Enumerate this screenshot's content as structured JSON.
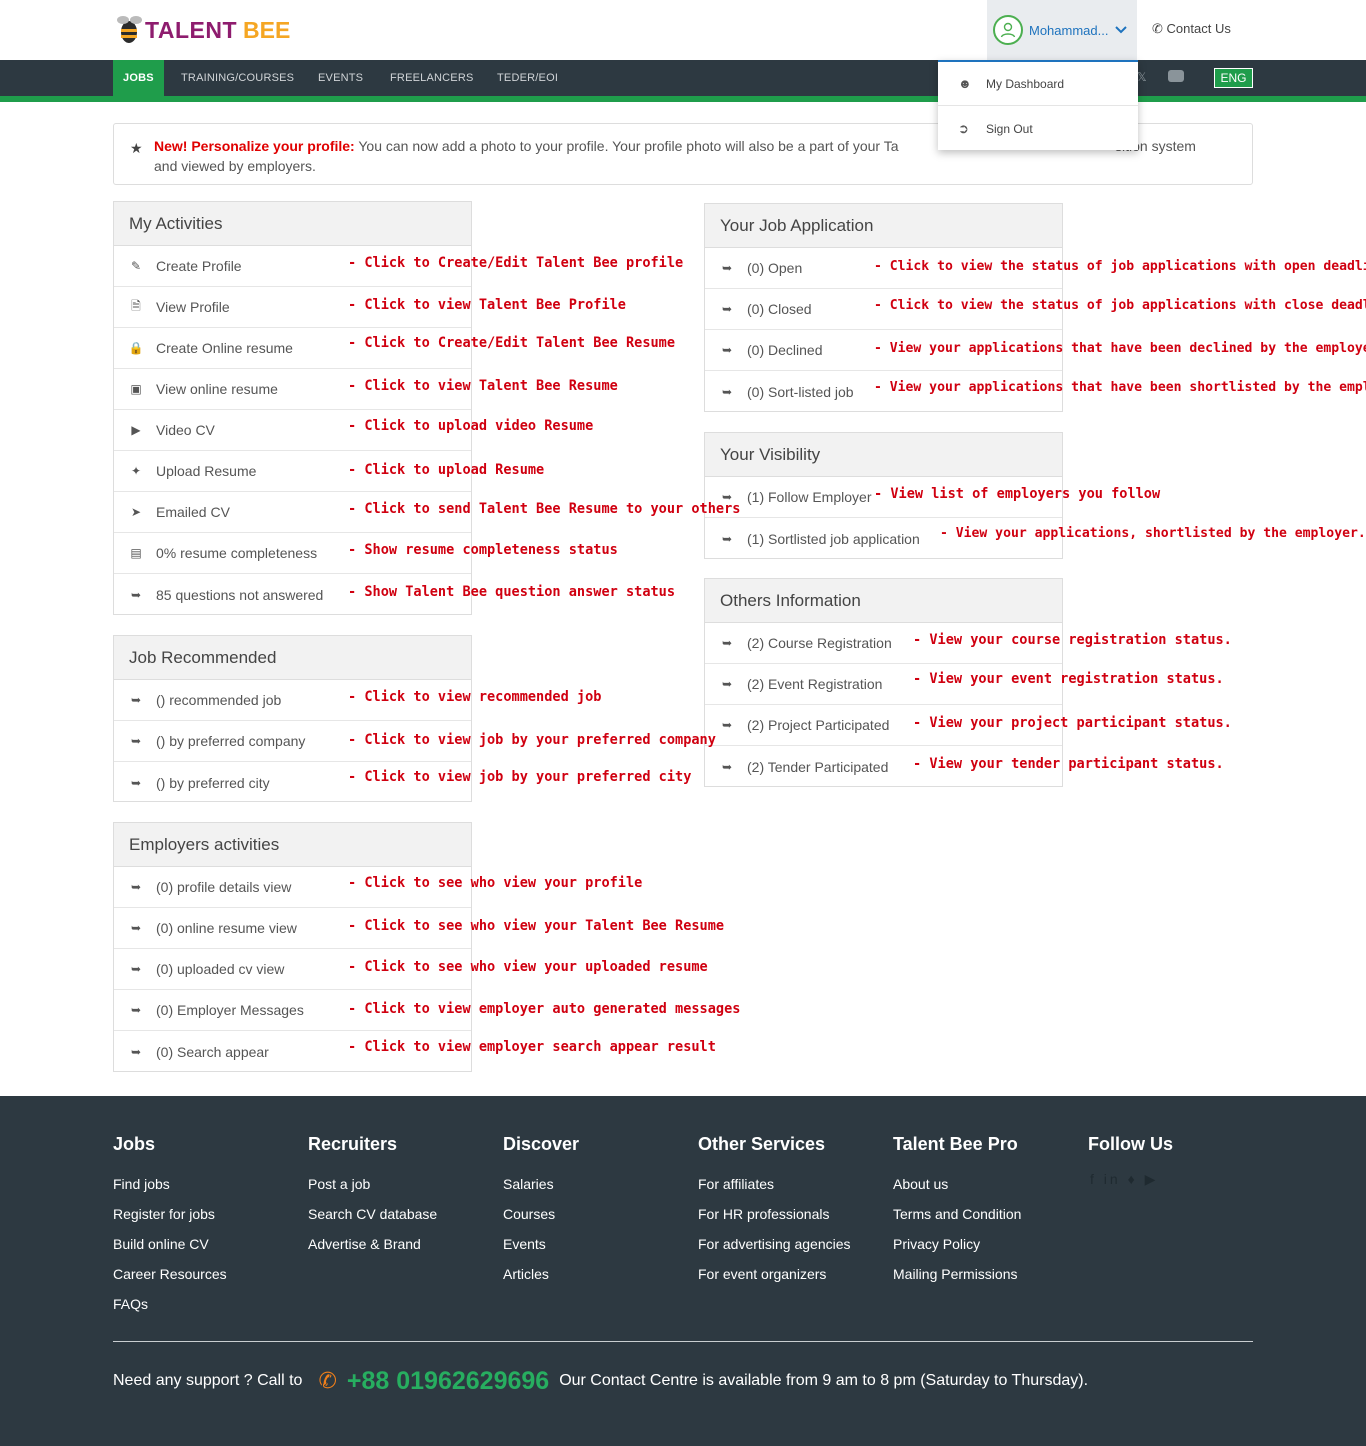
{
  "header": {
    "logo_part1": "TALENT",
    "logo_part2": "BEE",
    "user_name": "Mohammad...",
    "contact_label": "Contact Us"
  },
  "nav": {
    "tabs": [
      "JOBS",
      "TRAINING/COURSES",
      "EVENTS",
      "FREELANCERS",
      "TEDER/EOI"
    ],
    "active_tab": "JOBS",
    "lang": "ENG"
  },
  "user_menu": {
    "items": [
      "My Dashboard",
      "Sign Out"
    ]
  },
  "notice": {
    "highlight": "New! Personalize your profile:",
    "text": " You can now add a photo to your profile. Your profile photo will also be a part of your Ta",
    "text2": "sition system",
    "text3": "and viewed by employers."
  },
  "my_activities": {
    "title": "My Activities",
    "rows": [
      {
        "label": "Create Profile",
        "icon": "edit-icon",
        "note": "- Click to Create/Edit Talent Bee profile"
      },
      {
        "label": "View Profile",
        "icon": "profile-search-icon",
        "note": "- Click to view Talent Bee Profile"
      },
      {
        "label": "Create Online resume",
        "icon": "resume-lock-icon",
        "note": "- Click to Create/Edit Talent Bee Resume"
      },
      {
        "label": "View online resume",
        "icon": "monitor-icon",
        "note": "- Click to view Talent Bee Resume"
      },
      {
        "label": "Video CV",
        "icon": "video-icon",
        "note": "- Click to upload video Resume"
      },
      {
        "label": "Upload Resume",
        "icon": "puzzle-icon",
        "note": "- Click to upload Resume"
      },
      {
        "label": "Emailed CV",
        "icon": "send-icon",
        "note": "- Click to send Talent Bee Resume to your others"
      },
      {
        "label": "0% resume completeness",
        "icon": "id-card-icon",
        "note": "- Show resume completeness status"
      },
      {
        "label": "85 questions not answered",
        "icon": "arrow-dots-icon",
        "note": "- Show Talent Bee question answer status"
      }
    ]
  },
  "job_recommended": {
    "title": "Job Recommended",
    "rows": [
      {
        "label": "() recommended job",
        "note": "- Click to view recommended job"
      },
      {
        "label": "() by preferred company",
        "note": "- Click to view job by your preferred company"
      },
      {
        "label": "() by preferred city",
        "note": "- Click to view job by your preferred city"
      }
    ]
  },
  "employers_activities": {
    "title": "Employers activities",
    "rows": [
      {
        "label": "(0) profile details view",
        "note": "- Click to see who view your profile"
      },
      {
        "label": "(0) online resume view",
        "note": "- Click to see who view your Talent Bee Resume"
      },
      {
        "label": "(0) uploaded cv view",
        "note": "- Click to see who view your uploaded resume"
      },
      {
        "label": "(0) Employer Messages",
        "note": "- Click to view employer auto generated messages"
      },
      {
        "label": "(0) Search appear",
        "note": "- Click to view employer search appear result"
      }
    ]
  },
  "job_application": {
    "title": "Your Job Application",
    "rows": [
      {
        "label": "(0) Open",
        "note": "- Click to view the status of job applications with open deadlines."
      },
      {
        "label": "(0) Closed",
        "note": "- Click to view the status of job applications with close deadlines."
      },
      {
        "label": "(0) Declined",
        "note": "- View your applications that have been declined by the employer."
      },
      {
        "label": "(0) Sort-listed job",
        "note": "- View your applications that have been shortlisted by the employer."
      }
    ]
  },
  "visibility": {
    "title": "Your Visibility",
    "rows": [
      {
        "label": "(1) Follow Employer",
        "note": "- View list of employers you follow"
      },
      {
        "label": "(1) Sortlisted job application",
        "note": "- View your applications, shortlisted by the employer."
      }
    ]
  },
  "others_info": {
    "title": "Others Information",
    "rows": [
      {
        "label": "(2) Course Registration",
        "note": "- View your course registration status."
      },
      {
        "label": "(2) Event Registration",
        "note": "- View your event registration status."
      },
      {
        "label": "(2) Project Participated",
        "note": "- View your project participant status."
      },
      {
        "label": "(2) Tender Participated",
        "note": "- View your tender participant status."
      }
    ]
  },
  "footer": {
    "columns": [
      {
        "title": "Jobs",
        "links": [
          "Find jobs",
          "Register for jobs",
          "Build online CV",
          "Career Resources",
          "FAQs"
        ]
      },
      {
        "title": "Recruiters",
        "links": [
          "Post a job",
          "Search CV database",
          "Advertise & Brand"
        ]
      },
      {
        "title": "Discover",
        "links": [
          "Salaries",
          "Courses",
          "Events",
          "Articles"
        ]
      },
      {
        "title": "Other Services",
        "links": [
          "For affiliates",
          "For HR professionals",
          "For advertising agencies",
          "For event organizers"
        ]
      },
      {
        "title": "Talent Bee Pro",
        "links": [
          "About us",
          "Terms and Condition",
          "Privacy Policy",
          "Mailing Permissions"
        ]
      },
      {
        "title": "Follow Us",
        "links": []
      }
    ],
    "support_prefix": "Need any support ? Call to",
    "support_number": "+88 01962629696",
    "support_suffix": "Our Contact Centre is available from 9 am to 8 pm (Saturday to Thursday)."
  },
  "colors": {
    "brand_green": "#1f9d4b",
    "nav_dark": "#2d3941",
    "annotation_red": "#d00010"
  }
}
